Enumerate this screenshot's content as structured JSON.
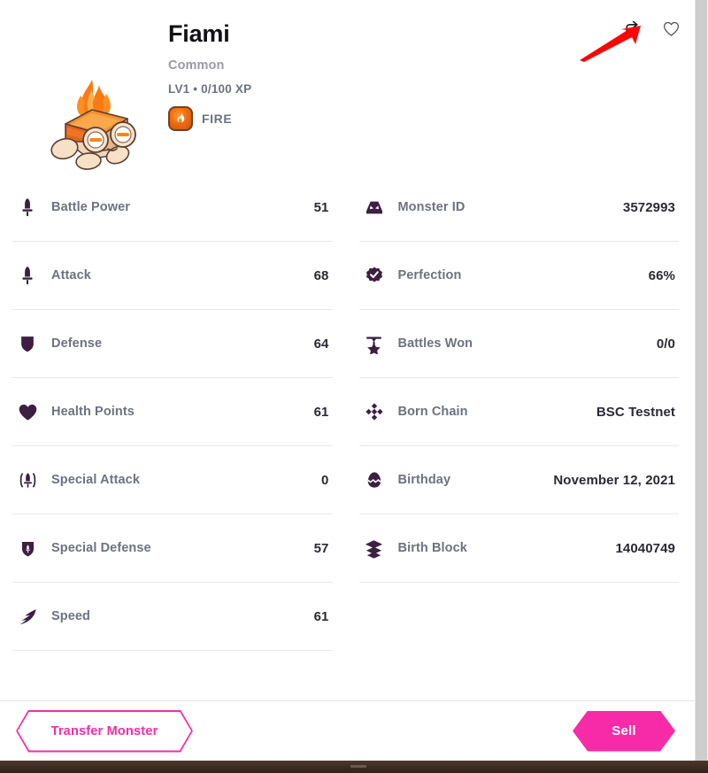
{
  "header": {
    "share_icon": "share-icon",
    "favorite_icon": "heart-icon",
    "annotation": "red-arrow-pointing-at-share"
  },
  "monster": {
    "name": "Fiami",
    "rarity": "Common",
    "level_xp": "LV1 • 0/100 XP",
    "type_label": "FIRE",
    "type_icon": "fire-icon",
    "art_icon": "campfire-monster"
  },
  "colors": {
    "accent_pink": "#f72aa8",
    "icon_purple": "#3d1f41",
    "label_gray": "#6d7280",
    "rarity_gray": "#9b9aa3",
    "value_dark": "#2b2a33",
    "fire_orange": "#f06a10",
    "annotation_red": "#ff0000",
    "footer_brown": "#3a2b21"
  },
  "stats_left": [
    {
      "icon": "sword-icon",
      "label": "Battle Power",
      "value": "51"
    },
    {
      "icon": "sword-icon",
      "label": "Attack",
      "value": "68"
    },
    {
      "icon": "shield-icon",
      "label": "Defense",
      "value": "64"
    },
    {
      "icon": "heart-filled-icon",
      "label": "Health Points",
      "value": "61"
    },
    {
      "icon": "special-sword-icon",
      "label": "Special Attack",
      "value": "0"
    },
    {
      "icon": "special-shield-icon",
      "label": "Special Defense",
      "value": "57"
    },
    {
      "icon": "wing-icon",
      "label": "Speed",
      "value": "61"
    }
  ],
  "stats_right": [
    {
      "icon": "monster-face-icon",
      "label": "Monster ID",
      "value": "3572993"
    },
    {
      "icon": "check-badge-icon",
      "label": "Perfection",
      "value": "66%"
    },
    {
      "icon": "medal-icon",
      "label": "Battles Won",
      "value": "0/0"
    },
    {
      "icon": "binance-chain-icon",
      "label": "Born Chain",
      "value": "BSC Testnet"
    },
    {
      "icon": "egg-icon",
      "label": "Birthday",
      "value": "November 12, 2021"
    },
    {
      "icon": "layers-icon",
      "label": "Birth Block",
      "value": "14040749"
    }
  ],
  "actions": {
    "transfer_label": "Transfer Monster",
    "sell_label": "Sell"
  }
}
